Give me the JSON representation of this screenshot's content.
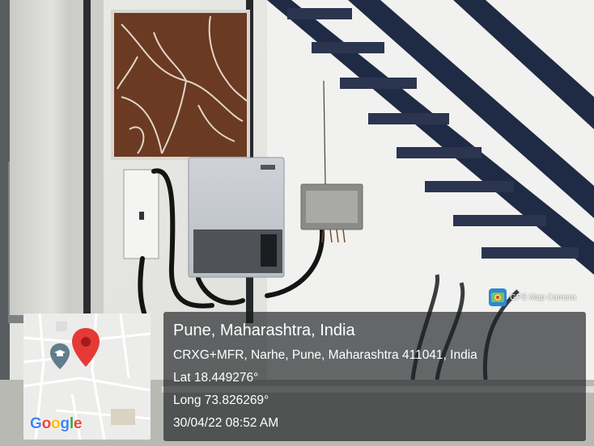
{
  "photo": {
    "subject": "wall-mounted-solar-inverter-under-metal-staircase"
  },
  "watermark": {
    "app_name": "GPS Map Camera",
    "app_icon": "map-pin-camera-icon"
  },
  "map": {
    "provider": "Google",
    "pin_icon": "red-location-pin-icon",
    "place_icon": "graduation-cap-place-icon"
  },
  "location": {
    "city_line": "Pune, Maharashtra, India",
    "address_line": "CRXG+MFR, Narhe, Pune, Maharashtra 411041, India",
    "lat_line": "Lat 18.449276°",
    "long_line": "Long 73.826269°",
    "datetime_line": "30/04/22 08:52 AM"
  },
  "colors": {
    "overlay_bg": "#1c1e22",
    "pin_red": "#e53935",
    "google_blue": "#4285f4",
    "google_red": "#ea4335",
    "google_yellow": "#fbbc05",
    "google_green": "#34a853"
  }
}
